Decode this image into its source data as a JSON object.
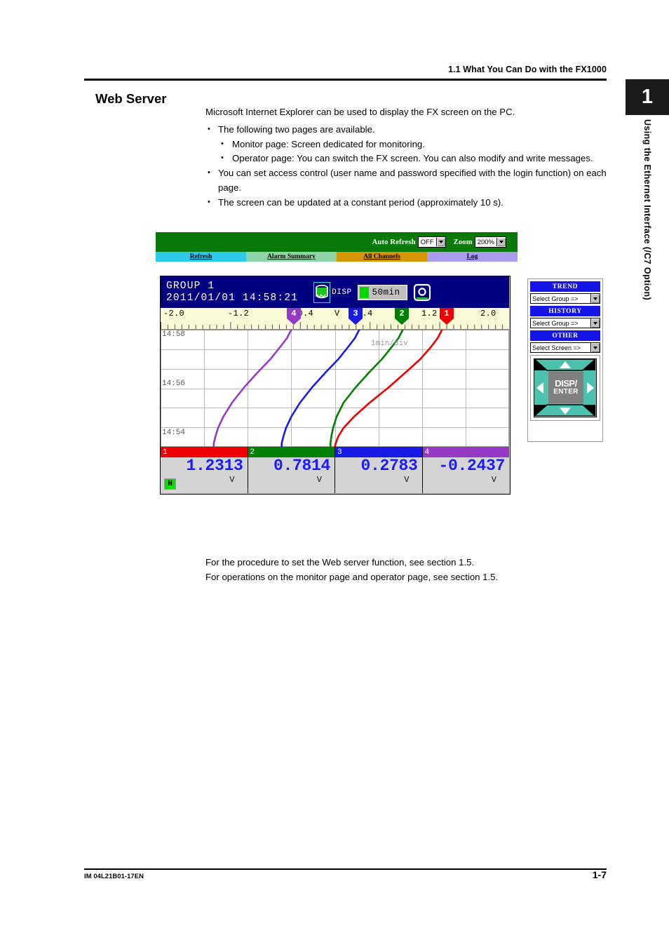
{
  "page": {
    "running_header": "1.1  What You Can Do with the FX1000",
    "tab_number": "1",
    "tab_label": "Using the Ethernet Interface (/C7 Option)",
    "section_title": "Web Server",
    "footer_left": "IM 04L21B01-17EN",
    "footer_right": "1-7"
  },
  "body": {
    "lead": "Microsoft Internet Explorer can be used to display the FX screen on the PC.",
    "bullets": [
      {
        "text": "The following two pages are available.",
        "sub": [
          "Monitor page: Screen dedicated for monitoring.",
          "Operator page: You can switch the FX screen. You can also modify and write messages."
        ]
      },
      {
        "text": "You can set access control (user name and password specified with the login function) on each page.",
        "sub": []
      },
      {
        "text": "The screen can be updated at a constant period (approximately 10 s).",
        "sub": []
      }
    ]
  },
  "caption": {
    "line1": "For the procedure to set the Web server function, see section 1.5.",
    "line2": "For operations on the monitor page and operator page, see section 1.5."
  },
  "screenshot": {
    "toolbar": {
      "background": "#097a09",
      "auto_refresh_label": "Auto Refresh",
      "auto_refresh_value": "OFF",
      "zoom_label": "Zoom",
      "zoom_value": "200%"
    },
    "nav": [
      {
        "label": "Refresh",
        "color": "#2bc9ec"
      },
      {
        "label": "Alarm Summary",
        "color": "#8fd3a8"
      },
      {
        "label": "All Channels",
        "color": "#d69500"
      },
      {
        "label": "Log",
        "color": "#a99cf0"
      }
    ],
    "device": {
      "group": "GROUP 1",
      "timestamp": "2011/01/01 14:58:21",
      "disp_label": "DISP",
      "span_value": "50min",
      "media_icon": "drum-icon",
      "camera_icon": "camera-icon",
      "titlebar_color": "#000080",
      "alarm_badge": "H"
    },
    "controls": {
      "groups": [
        {
          "header": "TREND",
          "dropdown": "Select Group =>"
        },
        {
          "header": "HISTORY",
          "dropdown": "Select Group =>"
        },
        {
          "header": "OTHER",
          "dropdown": "Select Screen =>"
        }
      ],
      "dpad": {
        "line1": "DISP/",
        "line2": "ENTER",
        "face_color": "#4cc2ae"
      }
    }
  },
  "chart_data": {
    "type": "line",
    "title": "GROUP 1 trend",
    "xlabel": "",
    "ylabel": "",
    "orientation": "vertical-time",
    "grid": true,
    "legend": "channel-markers",
    "annotation": "1min/div",
    "x_unit": "V",
    "xlim": [
      -2.0,
      2.0
    ],
    "x_ticks": [
      -2.0,
      -1.2,
      -0.4,
      0.4,
      1.2,
      2.0
    ],
    "x_tick_labels": [
      "-2.0",
      "-1.2",
      "-0.4",
      "0.4",
      "1.2",
      "2.0"
    ],
    "y_tick_labels": [
      "14:58",
      "14:56",
      "14:54"
    ],
    "time_per_div": "1min/div",
    "markers": [
      {
        "ch": "4",
        "value": -0.5,
        "color": "#9639c4"
      },
      {
        "ch": "3",
        "value": 0.28,
        "color": "#1919e6"
      },
      {
        "ch": "2",
        "value": 0.78,
        "color": "#008000"
      },
      {
        "ch": "1",
        "value": 1.23,
        "color": "#ee0000"
      }
    ],
    "series": [
      {
        "name": "1",
        "color": "#ee0000",
        "unit": "V",
        "present_value": "1.2313",
        "points": [
          [
            1.23,
            0
          ],
          [
            1.18,
            12
          ],
          [
            1.1,
            25
          ],
          [
            0.98,
            42
          ],
          [
            0.82,
            60
          ],
          [
            0.62,
            82
          ],
          [
            0.4,
            104
          ],
          [
            0.22,
            124
          ],
          [
            0.1,
            140
          ],
          [
            0.04,
            152
          ],
          [
            0.01,
            162
          ],
          [
            0.0,
            167
          ]
        ]
      },
      {
        "name": "2",
        "color": "#008000",
        "unit": "V",
        "present_value": "0.7814",
        "points": [
          [
            0.78,
            0
          ],
          [
            0.73,
            12
          ],
          [
            0.65,
            25
          ],
          [
            0.54,
            42
          ],
          [
            0.4,
            60
          ],
          [
            0.24,
            82
          ],
          [
            0.1,
            104
          ],
          [
            0.02,
            124
          ],
          [
            -0.02,
            140
          ],
          [
            -0.04,
            152
          ],
          [
            -0.05,
            162
          ],
          [
            -0.05,
            167
          ]
        ]
      },
      {
        "name": "3",
        "color": "#1919e6",
        "unit": "V",
        "present_value": "0.2783",
        "points": [
          [
            0.28,
            0
          ],
          [
            0.23,
            12
          ],
          [
            0.15,
            25
          ],
          [
            0.04,
            42
          ],
          [
            -0.1,
            60
          ],
          [
            -0.26,
            82
          ],
          [
            -0.4,
            104
          ],
          [
            -0.5,
            124
          ],
          [
            -0.56,
            140
          ],
          [
            -0.59,
            152
          ],
          [
            -0.61,
            162
          ],
          [
            -0.61,
            167
          ]
        ]
      },
      {
        "name": "4",
        "color": "#9639c4",
        "unit": "V",
        "present_value": "-0.2437",
        "points": [
          [
            -0.5,
            0
          ],
          [
            -0.55,
            12
          ],
          [
            -0.63,
            25
          ],
          [
            -0.74,
            42
          ],
          [
            -0.88,
            60
          ],
          [
            -1.04,
            82
          ],
          [
            -1.18,
            104
          ],
          [
            -1.28,
            124
          ],
          [
            -1.34,
            140
          ],
          [
            -1.37,
            152
          ],
          [
            -1.39,
            162
          ],
          [
            -1.39,
            167
          ]
        ]
      }
    ],
    "digital_panel": [
      {
        "ch": "1",
        "color": "#ee0000",
        "value": "1.2313",
        "unit": "V"
      },
      {
        "ch": "2",
        "color": "#008000",
        "value": "0.7814",
        "unit": "V"
      },
      {
        "ch": "3",
        "color": "#1919e6",
        "value": "0.2783",
        "unit": "V"
      },
      {
        "ch": "4",
        "color": "#9639c4",
        "value": "-0.2437",
        "unit": "V"
      }
    ]
  }
}
